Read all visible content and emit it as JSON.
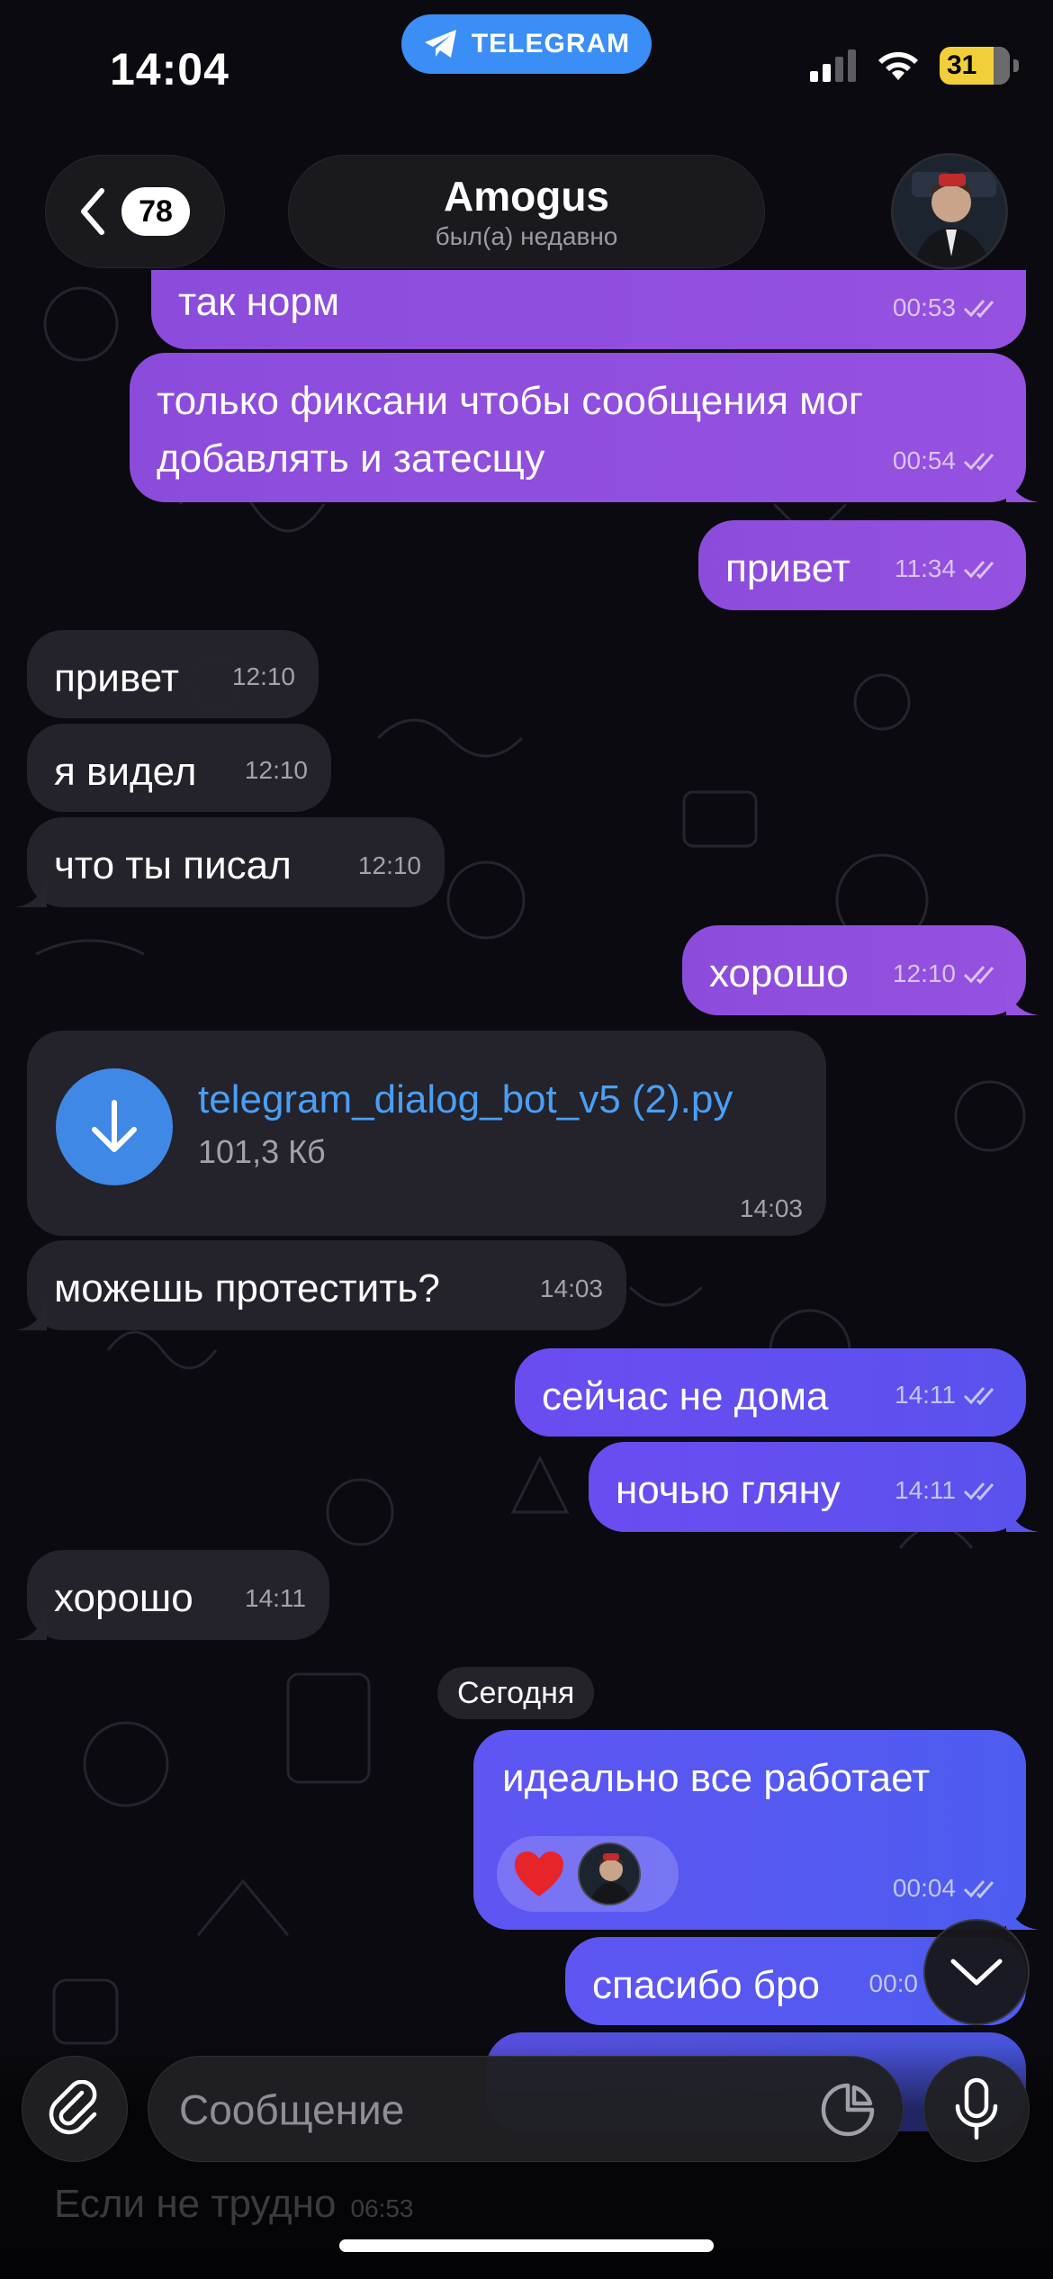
{
  "status_bar": {
    "time": "14:04",
    "app_pill": "TELEGRAM",
    "battery": "31"
  },
  "header": {
    "back_count": "78",
    "title": "Amogus",
    "subtitle": "был(а) недавно"
  },
  "messages": [
    {
      "id": "m1",
      "dir": "out",
      "text": "так норм",
      "time": "00:53"
    },
    {
      "id": "m2",
      "dir": "out",
      "text": "только фиксани чтобы сообщения мог добавлять и затесщу",
      "time": "00:54"
    },
    {
      "id": "m3",
      "dir": "out",
      "text": "привет",
      "time": "11:34"
    },
    {
      "id": "m4",
      "dir": "in",
      "text": "привет",
      "time": "12:10"
    },
    {
      "id": "m5",
      "dir": "in",
      "text": "я видел",
      "time": "12:10"
    },
    {
      "id": "m6",
      "dir": "in",
      "text": "что ты писал",
      "time": "12:10"
    },
    {
      "id": "m7",
      "dir": "out",
      "text": "хорошо",
      "time": "12:10"
    },
    {
      "id": "m8",
      "dir": "in",
      "type": "file",
      "file_name": "telegram_dialog_bot_v5 (2).py",
      "file_size": "101,3 Кб",
      "time": "14:03"
    },
    {
      "id": "m9",
      "dir": "in",
      "text": "можешь протестить?",
      "time": "14:03"
    },
    {
      "id": "m10",
      "dir": "out",
      "text": "сейчас не дома",
      "time": "14:11"
    },
    {
      "id": "m11",
      "dir": "out",
      "text": "ночью гляну",
      "time": "14:11"
    },
    {
      "id": "m12",
      "dir": "in",
      "text": "хорошо",
      "time": "14:11"
    },
    {
      "id": "m13",
      "dir": "out",
      "text": "идеально все работает",
      "time": "00:04",
      "reaction": "❤️"
    },
    {
      "id": "m14",
      "dir": "out",
      "text": "спасибо бро",
      "time": "00:0"
    }
  ],
  "date_separator": "Сегодня",
  "composer": {
    "placeholder": "Сообщение",
    "ghost_text": "Если не трудно",
    "ghost_time": "06:53"
  },
  "colors": {
    "outgoing": "#9551e0",
    "outgoing_blue": "#5a52ee",
    "incoming": "#26242c",
    "accent": "#3a8ef5",
    "file_link": "#4a9ff5"
  },
  "icons": [
    "telegram-plane-icon",
    "back-chevron-icon",
    "double-check-icon",
    "download-arrow-icon",
    "heart-icon",
    "scroll-down-chevron-icon",
    "paperclip-icon",
    "sticker-icon",
    "microphone-icon",
    "signal-icon",
    "wifi-icon",
    "battery-icon"
  ]
}
